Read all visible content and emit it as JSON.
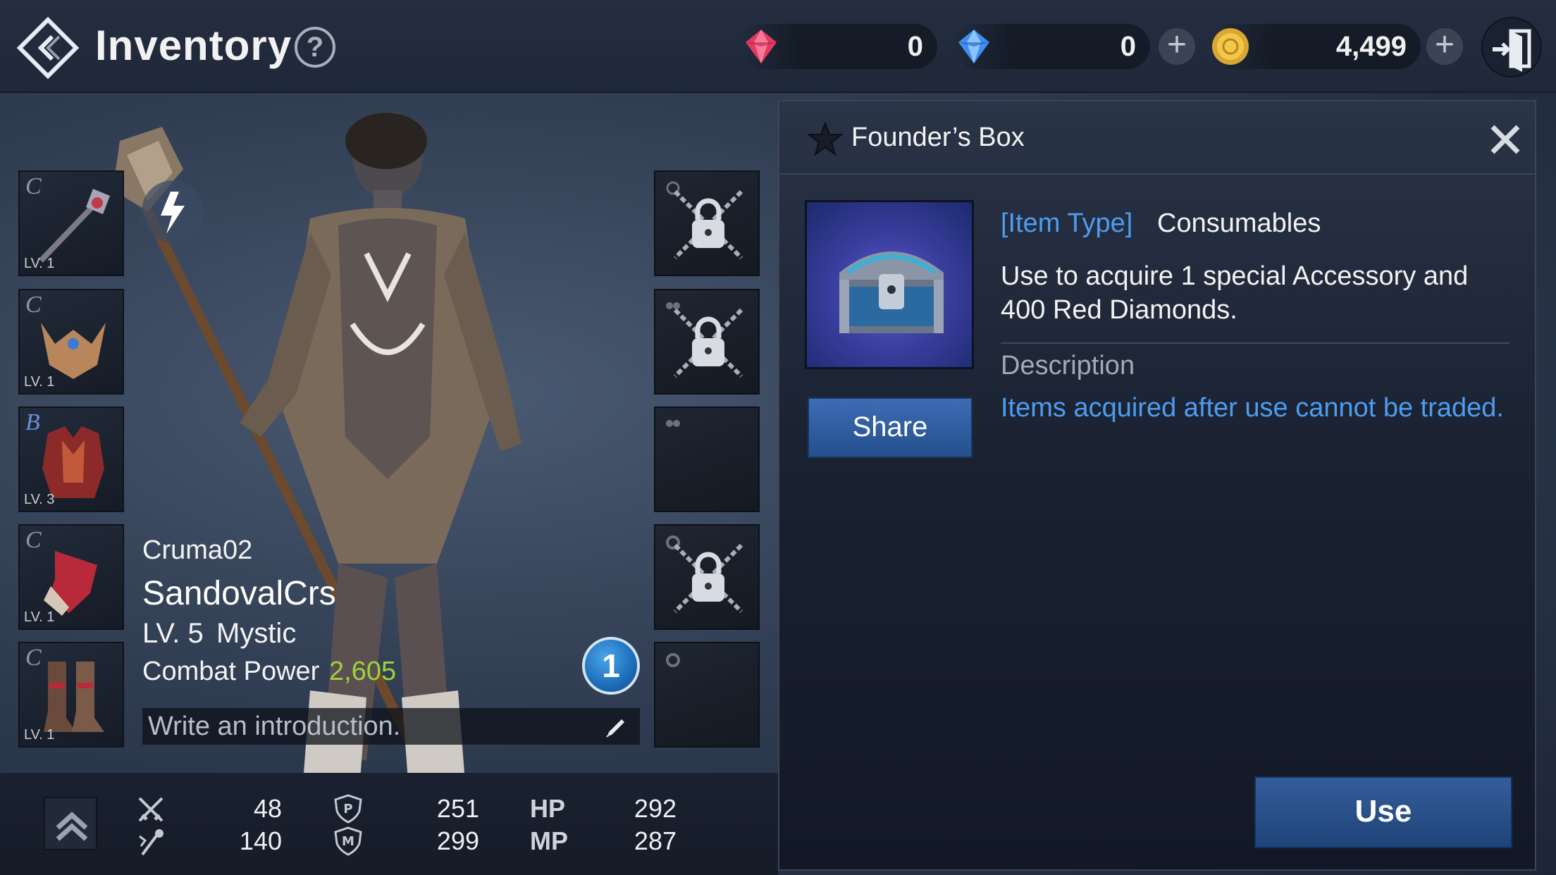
{
  "header": {
    "title": "Inventory",
    "help_label": "?"
  },
  "currencies": [
    {
      "name": "red-diamond",
      "value": "0",
      "color": "#e03a62"
    },
    {
      "name": "blue-diamond",
      "value": "0",
      "color": "#3f8ef0"
    },
    {
      "name": "adena",
      "value": "4,499",
      "color": "#d8a830"
    }
  ],
  "equipment": [
    {
      "grade": "C",
      "level": "LV. 1",
      "icon": "staff-icon"
    },
    {
      "grade": "C",
      "level": "LV. 1",
      "icon": "helmet-icon"
    },
    {
      "grade": "B",
      "level": "LV. 3",
      "icon": "armor-icon"
    },
    {
      "grade": "C",
      "level": "LV. 1",
      "icon": "gloves-icon"
    },
    {
      "grade": "C",
      "level": "LV. 1",
      "icon": "boots-icon"
    }
  ],
  "accessories": [
    {
      "slot": "necklace",
      "locked": true
    },
    {
      "slot": "earring",
      "locked": true
    },
    {
      "slot": "earring",
      "locked": false
    },
    {
      "slot": "ring",
      "locked": true
    },
    {
      "slot": "ring",
      "locked": false
    }
  ],
  "character": {
    "server": "Cruma02",
    "name": "SandovalCrs",
    "level": "LV. 5",
    "class": "Mystic",
    "combat_power_label": "Combat Power",
    "combat_power": "2,605",
    "notification_count": "1",
    "intro_placeholder": "Write an introduction."
  },
  "stats": {
    "attack": "48",
    "magic_attack": "140",
    "p_defense": "251",
    "m_defense": "299",
    "hp_label": "HP",
    "hp": "292",
    "mp_label": "MP",
    "mp": "287"
  },
  "item_panel": {
    "title": "Founder’s Box",
    "type_label": "[Item Type]",
    "type_value": "Consumables",
    "description_line1": "Use to acquire 1 special Accessory and",
    "description_line2": "400 Red Diamonds.",
    "description_heading": "Description",
    "description_note": "Items acquired after use cannot be traded.",
    "share_label": "Share",
    "use_label": "Use"
  }
}
